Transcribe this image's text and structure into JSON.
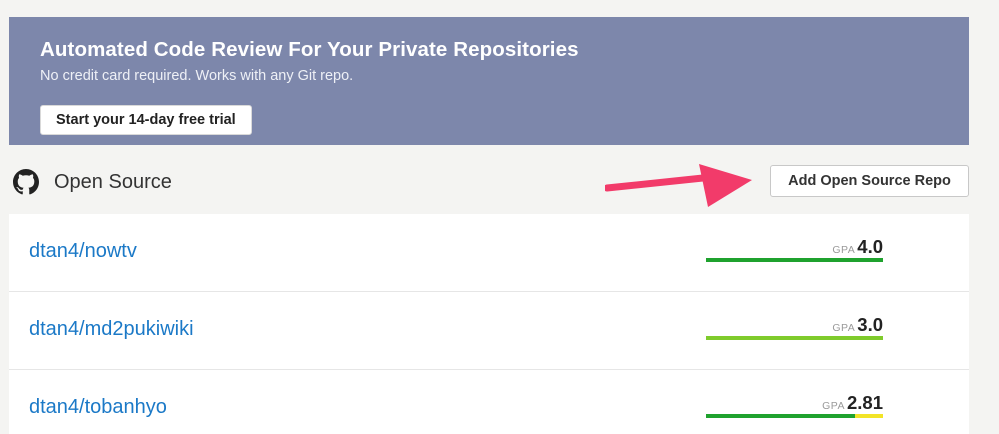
{
  "promo": {
    "title": "Automated Code Review For Your Private Repositories",
    "subtitle": "No credit card required. Works with any Git repo.",
    "cta_label": "Start your 14-day free trial",
    "background": "#7d87ab"
  },
  "section": {
    "icon": "github-icon",
    "title": "Open Source",
    "add_button_label": "Add Open Source Repo",
    "annotation": {
      "icon": "arrow-right-icon",
      "color": "#f23b6a"
    }
  },
  "repos": [
    {
      "name": "dtan4/nowtv",
      "gpa_label": "GPA",
      "gpa": "4.0",
      "rating": [
        {
          "share": 1.0,
          "color": "#1fa22e"
        }
      ]
    },
    {
      "name": "dtan4/md2pukiwiki",
      "gpa_label": "GPA",
      "gpa": "3.0",
      "rating": [
        {
          "share": 1.0,
          "color": "#7fcb2c"
        }
      ]
    },
    {
      "name": "dtan4/tobanhyo",
      "gpa_label": "GPA",
      "gpa": "2.81",
      "rating": [
        {
          "share": 0.84,
          "color": "#1fa22e"
        },
        {
          "share": 0.16,
          "color": "#f2e427"
        }
      ]
    }
  ]
}
